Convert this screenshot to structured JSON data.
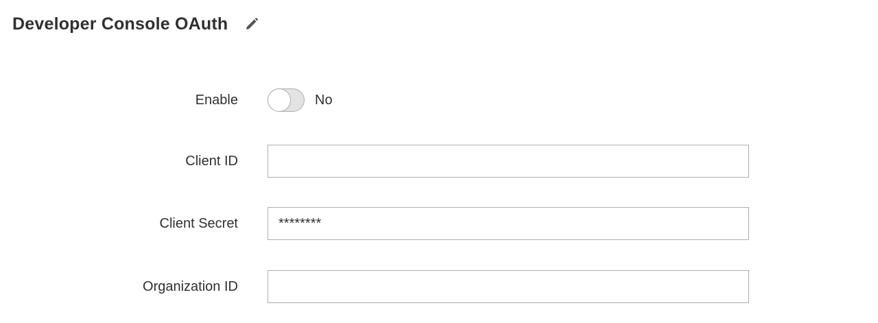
{
  "section": {
    "title": "Developer Console OAuth",
    "edit_icon": "pencil-icon"
  },
  "fields": {
    "enable": {
      "label": "Enable",
      "state_text": "No",
      "checked": false
    },
    "client_id": {
      "label": "Client ID",
      "value": ""
    },
    "client_secret": {
      "label": "Client Secret",
      "value": "********"
    },
    "organization_id": {
      "label": "Organization ID",
      "value": ""
    }
  },
  "colors": {
    "text": "#303030",
    "input_border": "#adadad",
    "toggle_off_bg": "#e3e3e3"
  }
}
